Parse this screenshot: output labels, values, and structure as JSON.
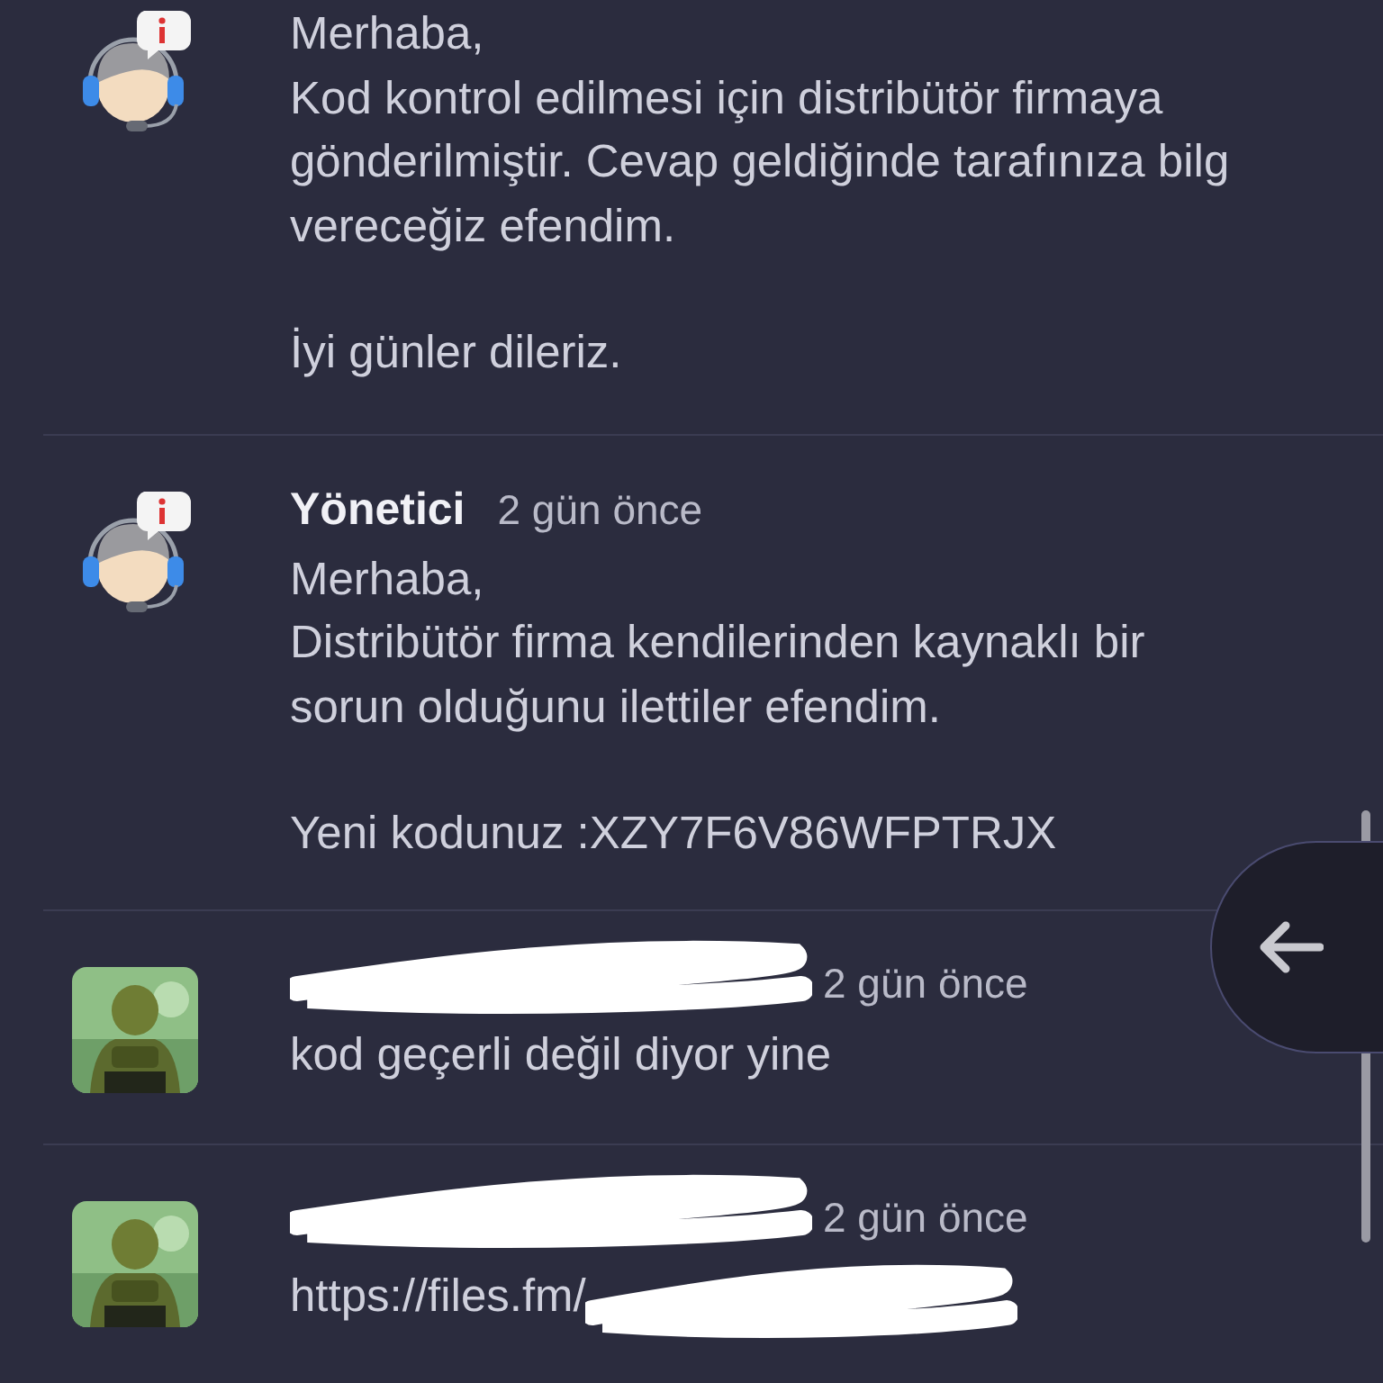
{
  "messages": [
    {
      "kind": "support",
      "paragraphs": [
        [
          "Merhaba,",
          "Kod kontrol edilmesi için distribütör firmaya",
          "gönderilmiştir. Cevap geldiğinde tarafınıza bilg",
          "vereceğiz efendim."
        ],
        [
          "İyi günler dileriz."
        ]
      ]
    },
    {
      "kind": "support",
      "author": "Yönetici",
      "time": "2 gün önce",
      "paragraphs": [
        [
          "Merhaba,",
          "Distribütör firma kendilerinden kaynaklı bir",
          "sorun olduğunu ilettiler efendim."
        ],
        [
          "Yeni kodunuz :XZY7F6V86WFPTRJX"
        ]
      ]
    },
    {
      "kind": "user",
      "author_redacted": true,
      "time": "2 gün önce",
      "paragraphs": [
        [
          "kod geçerli değil diyor yine"
        ]
      ]
    },
    {
      "kind": "user",
      "author_redacted": true,
      "time": "2 gün önce",
      "paragraphs": [
        [
          "https://files.fm/"
        ]
      ],
      "text_redacted": true
    }
  ]
}
